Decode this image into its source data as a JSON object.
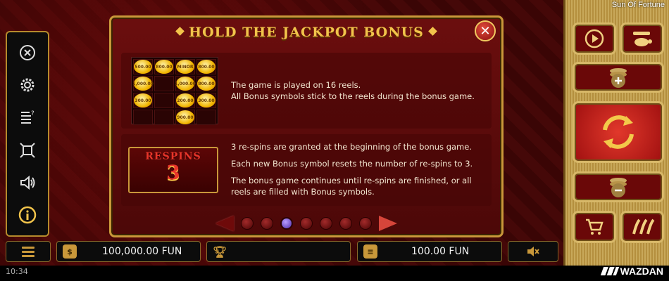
{
  "app": {
    "title": "Sun Of Fortune",
    "brand": "WAZDAN",
    "clock": "10:34"
  },
  "left_menu": {
    "items": [
      {
        "name": "close",
        "icon": "close-icon"
      },
      {
        "name": "settings",
        "icon": "gear-icon"
      },
      {
        "name": "paytable",
        "icon": "paytable-icon"
      },
      {
        "name": "fullscreen",
        "icon": "fullscreen-icon"
      },
      {
        "name": "sound",
        "icon": "speaker-icon"
      },
      {
        "name": "info",
        "icon": "info-icon"
      }
    ]
  },
  "modal": {
    "title": "HOLD THE JACKPOT BONUS",
    "close_icon": "close-icon",
    "panel1": {
      "reel_values": [
        [
          "500.00",
          "800.00",
          "MINOR",
          "800.00"
        ],
        [
          "1,000.00",
          "",
          "1,000.00",
          "800.00"
        ],
        [
          "300.00",
          "",
          "200.00",
          "300.00"
        ],
        [
          "",
          "",
          "900.00",
          ""
        ]
      ],
      "lines": [
        "The game is played on 16 reels.",
        "All Bonus symbols stick to the reels during the bonus game."
      ]
    },
    "panel2": {
      "respins_label": "RESPINS",
      "respins_count": "3",
      "lines": [
        "3 re-spins are granted at the beginning of the bonus game.",
        "Each new Bonus symbol resets the number of re-spins to 3.",
        "The bonus game continues until re-spins are finished, or all reels are filled with Bonus symbols."
      ]
    },
    "pager": {
      "pages": 7,
      "active": 2
    }
  },
  "bottom_bar": {
    "menu_icon": "menu-icon",
    "balance_icon": "money-bag-icon",
    "balance": "100,000.00 FUN",
    "win_icon": "trophy-icon",
    "win": "",
    "bet_icon": "coins-icon",
    "bet": "100.00 FUN",
    "mute_icon": "mute-icon"
  },
  "right_panel": {
    "buttons": [
      {
        "name": "autoplay",
        "icon": "play-icon"
      },
      {
        "name": "turbo",
        "icon": "turtle-icon"
      },
      {
        "name": "bet-increase",
        "icon": "coins-plus-icon"
      },
      {
        "name": "spin",
        "icon": "spin-icon"
      },
      {
        "name": "bet-decrease",
        "icon": "coins-minus-icon"
      },
      {
        "name": "buy",
        "icon": "cart-icon"
      },
      {
        "name": "volatility",
        "icon": "chili-icon"
      }
    ]
  },
  "colors": {
    "gold": "#c9983a",
    "title": "#f2c44b",
    "respins": "#e8352a",
    "bg": "#4c0808"
  }
}
